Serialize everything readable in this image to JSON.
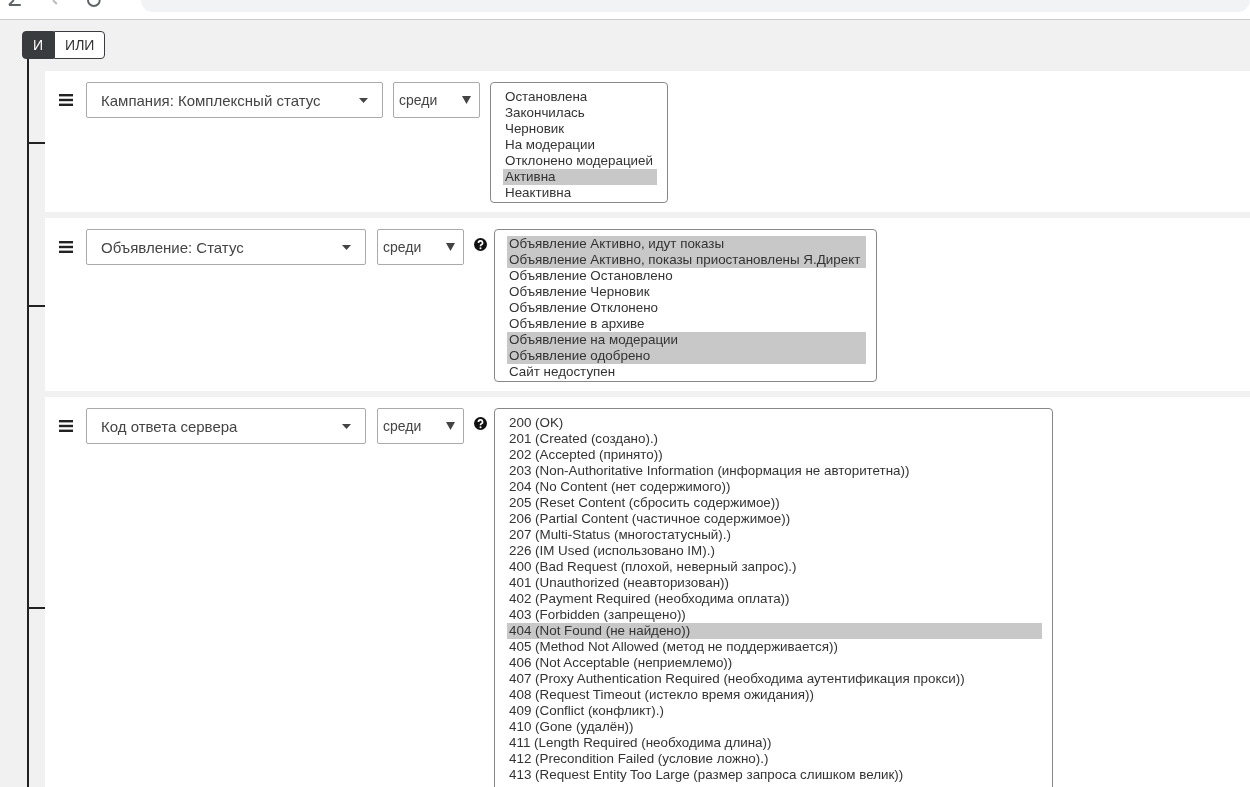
{
  "logic": [
    {
      "label": "И",
      "selected": true
    },
    {
      "label": "ИЛИ",
      "selected": false
    }
  ],
  "rules": [
    {
      "field": "Кампания: Комплексный статус",
      "operator": "среди",
      "has_help": false,
      "options": [
        {
          "label": "Остановлена",
          "selected": false
        },
        {
          "label": "Закончилась",
          "selected": false
        },
        {
          "label": "Черновик",
          "selected": false
        },
        {
          "label": "На модерации",
          "selected": false
        },
        {
          "label": "Отклонено модерацией",
          "selected": false
        },
        {
          "label": "Активна",
          "selected": true
        },
        {
          "label": "Неактивна",
          "selected": false
        }
      ]
    },
    {
      "field": "Объявление: Статус",
      "operator": "среди",
      "has_help": true,
      "options": [
        {
          "label": "Объявление Активно, идут показы",
          "selected": true
        },
        {
          "label": "Объявление Активно, показы приостановлены Я.Директ",
          "selected": true
        },
        {
          "label": "Объявление Остановлено",
          "selected": false
        },
        {
          "label": "Объявление Черновик",
          "selected": false
        },
        {
          "label": "Объявление Отклонено",
          "selected": false
        },
        {
          "label": "Объявление в архиве",
          "selected": false
        },
        {
          "label": "Объявление на модерации",
          "selected": true
        },
        {
          "label": "Объявление одобрено",
          "selected": true
        },
        {
          "label": "Сайт недоступен",
          "selected": false
        }
      ]
    },
    {
      "field": "Код ответа сервера",
      "operator": "среди",
      "has_help": true,
      "options": [
        {
          "label": "200 (OK)",
          "selected": false
        },
        {
          "label": "201 (Created (создано).)",
          "selected": false
        },
        {
          "label": "202 (Accepted (принято))",
          "selected": false
        },
        {
          "label": "203 (Non-Authoritative Information (информация не авторитетна))",
          "selected": false
        },
        {
          "label": "204 (No Content (нет содержимого))",
          "selected": false
        },
        {
          "label": "205 (Reset Content (сбросить содержимое))",
          "selected": false
        },
        {
          "label": "206 (Partial Content (частичное содержимое))",
          "selected": false
        },
        {
          "label": "207 (Multi-Status (многостатусный).)",
          "selected": false
        },
        {
          "label": "226 (IM Used (использовано IM).)",
          "selected": false
        },
        {
          "label": "400 (Bad Request (плохой, неверный запрос).)",
          "selected": false
        },
        {
          "label": "401 (Unauthorized (неавторизован))",
          "selected": false
        },
        {
          "label": "402 (Payment Required (необходима оплата))",
          "selected": false
        },
        {
          "label": "403 (Forbidden (запрещено))",
          "selected": false
        },
        {
          "label": "404 (Not Found (не найдено))",
          "selected": true
        },
        {
          "label": "405 (Method Not Allowed (метод не поддерживается))",
          "selected": false
        },
        {
          "label": "406 (Not Acceptable (неприемлемо))",
          "selected": false
        },
        {
          "label": "407 (Proxy Authentication Required (необходима аутентификация прокси))",
          "selected": false
        },
        {
          "label": "408 (Request Timeout (истекло время ожидания))",
          "selected": false
        },
        {
          "label": "409 (Conflict (конфликт).)",
          "selected": false
        },
        {
          "label": "410 (Gone (удалён))",
          "selected": false
        },
        {
          "label": "411 (Length Required (необходима длина))",
          "selected": false
        },
        {
          "label": "412 (Precondition Failed (условие ложно).)",
          "selected": false
        },
        {
          "label": "413 (Request Entity Too Large (размер запроса слишком велик))",
          "selected": false
        }
      ]
    }
  ]
}
